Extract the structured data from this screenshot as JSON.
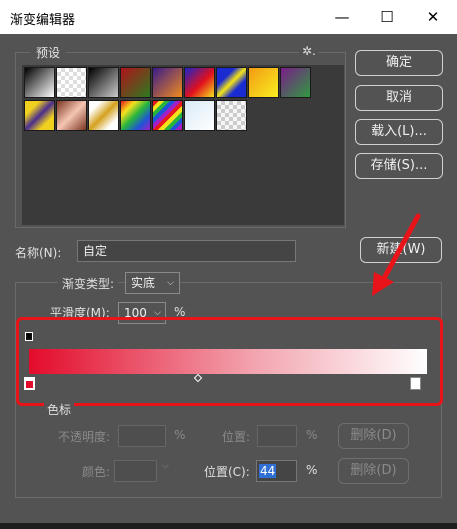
{
  "window": {
    "title": "渐变编辑器",
    "minimize_glyph": "—",
    "maximize_glyph": "☐",
    "close_glyph": "✕"
  },
  "presets": {
    "label": "预设",
    "menu_glyph": "✲.",
    "swatches": [
      "linear-gradient(135deg,#000 0%,#fff 100%)",
      "repeating-conic-gradient(#ddd 0 25%,#fff 0 50%) 0 0/8px 8px",
      "linear-gradient(135deg,#000 0%,#ccc 100%)",
      "linear-gradient(135deg,#b0131b 0%,#2d7a1f 100%)",
      "linear-gradient(135deg,#3a1b8a 0%,#f18a1d 100%)",
      "linear-gradient(135deg,#1a24c9 0%,#e0101d 55%,#f5e21d 100%)",
      "linear-gradient(135deg,#1a2bd1 30%,#f4e515 50%,#1a2bd1 70%)",
      "linear-gradient(135deg,#f39b12 0%,#f8ef22 100%)",
      "linear-gradient(135deg,#7a1c89 0%,#2f9a3f 100%)",
      "linear-gradient(135deg,#f1d11f 25%,#4a2d8e 50%,#f1d11f 75%)",
      "linear-gradient(135deg,#7a3520 0%,#f6c6b3 50%,#7a3520 100%)",
      "linear-gradient(135deg,#fff 20%,#d4a11e 50%,#fff 80%)",
      "linear-gradient(135deg,#e6191c,#f5e11c,#27b53e,#1e55d6,#a21ec9)",
      "repeating-linear-gradient(135deg,#e6191c 0 4px,#f5e11c 4px 8px,#27b53e 8px 12px,#1e55d6 12px 16px,#a21ec9 16px 20px)",
      "linear-gradient(135deg,#d9eaf7 0%,#ffffff 100%)",
      "repeating-conic-gradient(#ccc 0 25%,#f5f5f5 0 50%) 0 0/8px 8px"
    ]
  },
  "buttons": {
    "ok": "确定",
    "cancel": "取消",
    "load": "载入(L)...",
    "save": "存储(S)...",
    "new": "新建(W)"
  },
  "name": {
    "label": "名称(N):",
    "value": "自定"
  },
  "gradient_type": {
    "label": "渐变类型:",
    "value": "实底",
    "smoothness_label": "平滑度(M):",
    "smoothness_value": "100",
    "percent": "%"
  },
  "gradient": {
    "start_color": "#e30b2b",
    "mid_color": "#f2a3ae",
    "end_color": "#ffffff",
    "midpoint_percent": 44
  },
  "stops": {
    "section_label": "色标",
    "opacity_label": "不透明度:",
    "opacity_location_label": "位置:",
    "color_label": "颜色:",
    "location_label": "位置(C):",
    "location_value": "44",
    "percent": "%",
    "delete_label": "删除(D)"
  },
  "annotation": {
    "color": "#e8141a"
  }
}
